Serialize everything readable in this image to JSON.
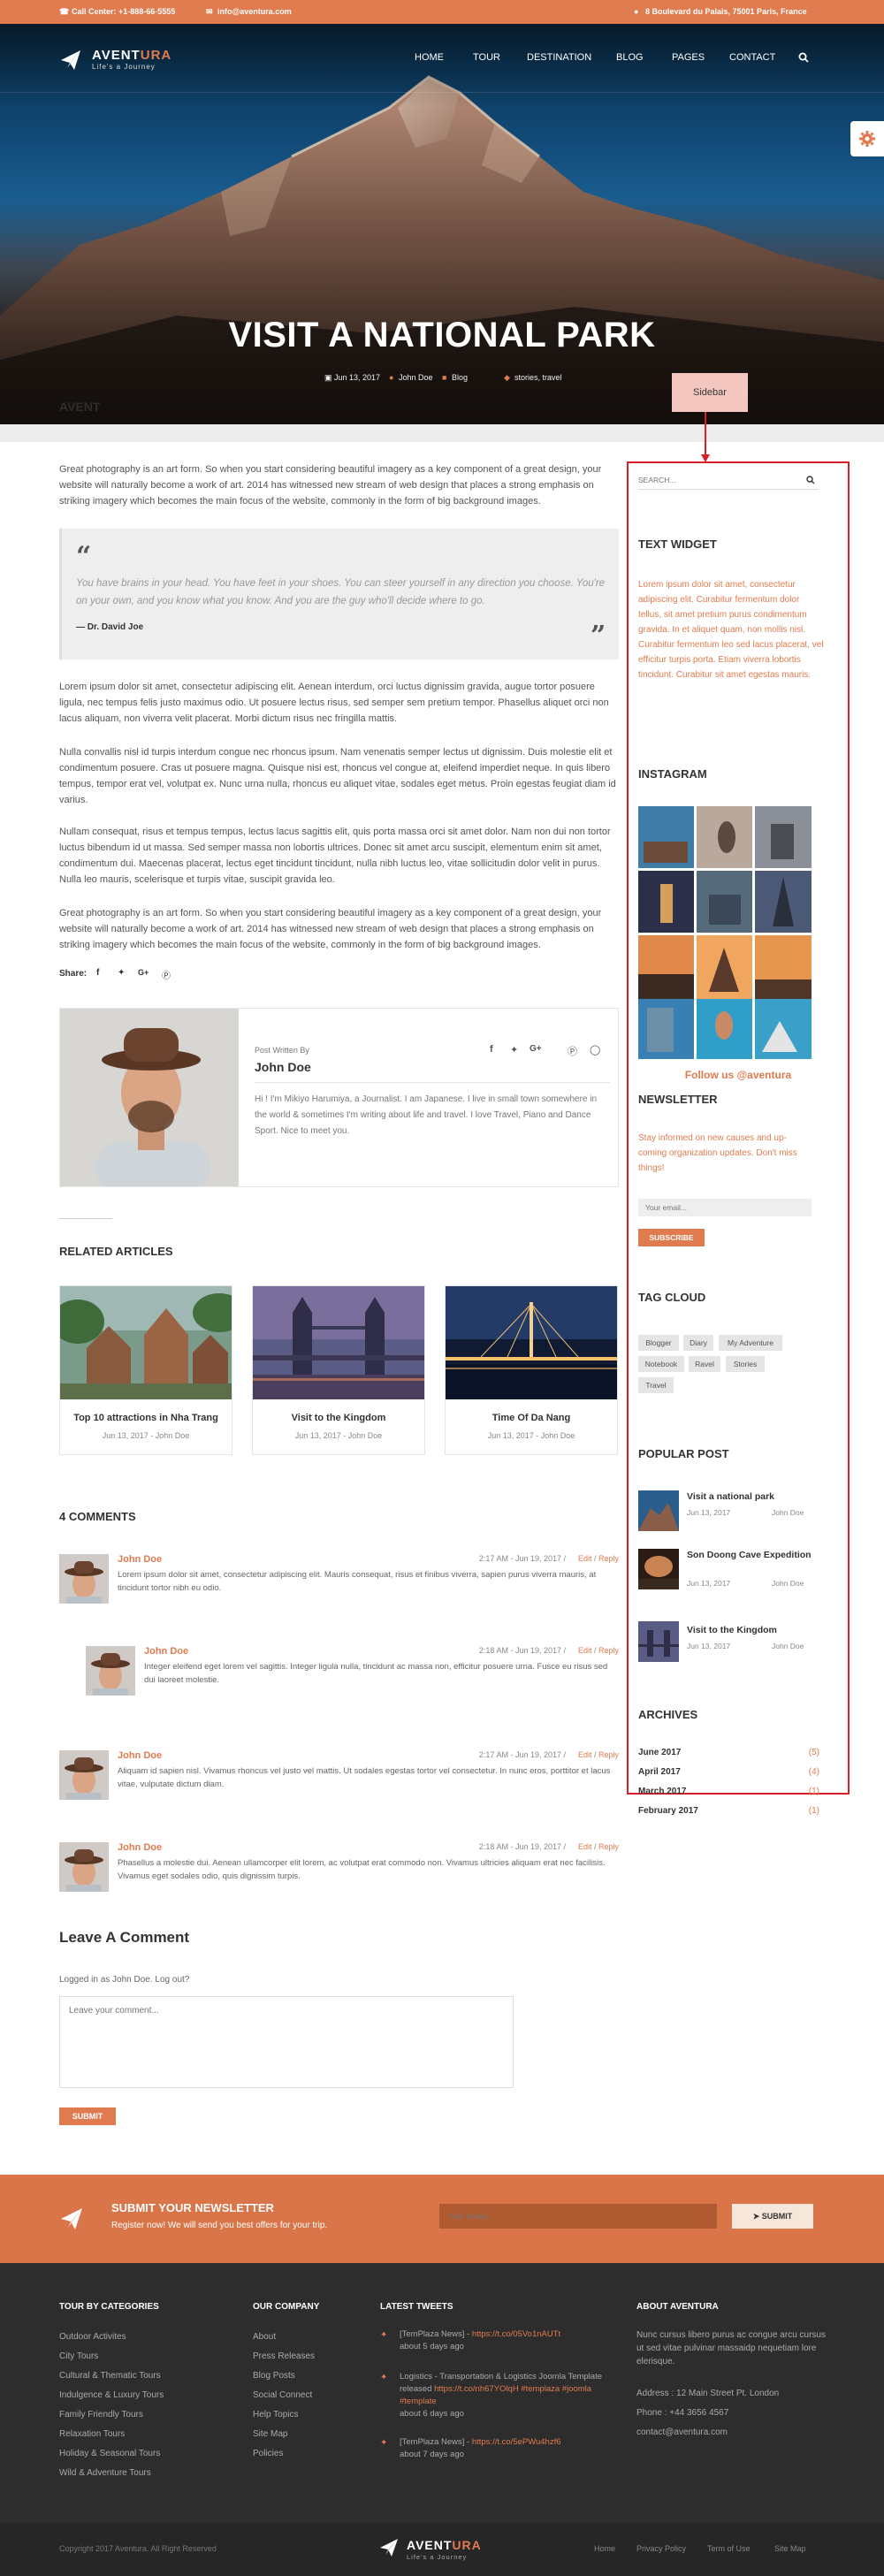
{
  "topbar": {
    "call": "Call Center: +1-888-66-5555",
    "email": "info@aventura.com",
    "address": "8 Boulevard du Palais, 75001 Paris, France"
  },
  "brand": {
    "name_a": "AVENT",
    "name_b": "URA",
    "tagline": "Life's a Journey"
  },
  "nav": {
    "items": [
      "HOME",
      "TOUR",
      "DESTINATION",
      "BLOG",
      "PAGES",
      "CONTACT"
    ]
  },
  "hero": {
    "title": "VISIT A NATIONAL PARK",
    "date": "Jun 13, 2017",
    "author": "John Doe",
    "category": "Blog",
    "tags": "stories, travel"
  },
  "annotation": {
    "sidebar_label": "Sidebar"
  },
  "article": {
    "p1": "Great photography is an art form. So when you start considering beautiful imagery as a key component of a great design, your website will naturally become a work of art. 2014 has witnessed new stream of web design that places a strong emphasis on striking imagery which becomes the main focus of the website, commonly in the form of big background images.",
    "quote_text": "You have brains in your head. You have feet in your shoes. You can steer yourself in any direction you choose. You're on your own, and you know what you know. And you are the guy who'll decide where to go.",
    "quote_author": "— Dr. David Joe",
    "p2": "Lorem ipsum dolor sit amet, consectetur adipiscing elit. Aenean interdum, orci luctus dignissim gravida, augue tortor posuere ligula, nec tempus felis justo maximus odio. Ut posuere lectus risus, sed semper sem pretium tempor. Phasellus aliquet orci non lacus aliquam, non viverra velit placerat. Morbi dictum risus nec fringilla mattis.",
    "p3": "Nulla convallis nisl id turpis interdum congue nec rhoncus ipsum. Nam venenatis semper lectus ut dignissim. Duis molestie elit et condimentum posuere. Cras ut posuere magna. Quisque nisi est, rhoncus vel congue at, eleifend imperdiet neque. In quis libero tempus, tempor erat vel, volutpat ex. Nunc urna nulla, rhoncus eu aliquet vitae, sodales eget metus. Proin egestas feugiat diam id varius.",
    "p4": "Nullam consequat, risus et tempus tempus, lectus lacus sagittis elit, quis porta massa orci sit amet dolor. Nam non dui non tortor luctus bibendum id ut massa. Sed semper massa non lobortis ultrices. Donec sit amet arcu suscipit, elementum enim sit amet, condimentum dui. Maecenas placerat, lectus eget tincidunt tincidunt, nulla nibh luctus leo, vitae sollicitudin dolor velit in purus. Nulla leo mauris, scelerisque et turpis vitae, suscipit gravida leo.",
    "p5": "Great photography is an art form. So when you start considering beautiful imagery as a key component of a great design, your website will naturally become a work of art. 2014 has witnessed new stream of web design that places a strong emphasis on striking imagery which becomes the main focus of the website, commonly in the form of big background images.",
    "share_label": "Share:"
  },
  "author_box": {
    "label": "Post Written By",
    "name": "John Doe",
    "bio": "Hi ! I'm Mikiyo Harumiya, a Journalist. I am Japanese. I live in small town somewhere in the world & sometimes I'm writing about life and travel. I love Travel, Piano and Dance Sport. Nice to meet you."
  },
  "related": {
    "heading": "RELATED ARTICLES",
    "items": [
      {
        "title": "Top 10 attractions in Nha Trang",
        "meta": "Jun 13, 2017 - John Doe"
      },
      {
        "title": "Visit to the Kingdom",
        "meta": "Jun 13, 2017 - John Doe"
      },
      {
        "title": "Time Of Da Nang",
        "meta": "Jun 13, 2017 - John Doe"
      }
    ]
  },
  "comments": {
    "heading": "4 COMMENTS",
    "items": [
      {
        "name": "John Doe",
        "date": "2:17 AM - Jun 19, 2017 /",
        "edit": "Edit",
        "reply": "Reply",
        "text": "Lorem ipsum dolor sit amet, consectetur adipiscing elit. Mauris consequat, risus et finibus viverra, sapien purus viverra mauris, at tincidunt tortor nibh eu odio."
      },
      {
        "name": "John Doe",
        "date": "2:18 AM - Jun 19, 2017 /",
        "edit": "Edit",
        "reply": "Reply",
        "text": "Integer eleifend eget lorem vel sagittis. Integer ligula nulla, tincidunt ac massa non, efficitur posuere urna. Fusce eu risus sed dui laoreet molestie."
      },
      {
        "name": "John Doe",
        "date": "2:17 AM - Jun 19, 2017 /",
        "edit": "Edit",
        "reply": "Reply",
        "text": "Aliquam id sapien nisl. Vivamus rhoncus vel justo vel mattis. Ut sodales egestas tortor vel consectetur. In nunc eros, porttitor et lacus vitae, vulputate dictum diam."
      },
      {
        "name": "John Doe",
        "date": "2:18 AM - Jun 19, 2017 /",
        "edit": "Edit",
        "reply": "Reply",
        "text": "Phasellus a molestie dui. Aenean ullamcorper elit lorem, ac volutpat erat commodo non. Vivamus ultricies aliquam erat nec facilisis. Vivamus eget sodales odio, quis dignissim turpis."
      }
    ]
  },
  "leave": {
    "heading": "Leave A Comment",
    "logged": "Logged in as John Doe. Log out?",
    "placeholder": "Leave your comment...",
    "submit": "SUBMIT"
  },
  "sidebar": {
    "search_placeholder": "SEARCH...",
    "text_widget_title": "TEXT WIDGET",
    "text_widget_body": "Lorem ipsum dolor sit amet, consectetur adipiscing elit. Curabitur fermentum dolor tellus, sit amet pretium purus condimentum gravida. In et aliquet quam, non mollis nisl. Curabitur fermentum leo sed lacus placerat, vel efficitur turpis porta. Etiam viverra lobortis tincidunt. Curabitur sit amet egestas mauris.",
    "instagram_title": "INSTAGRAM",
    "follow": "Follow us @aventura",
    "newsletter_title": "NEWSLETTER",
    "newsletter_body": "Stay informed on new causes and up-coming organization updates. Don't miss things!",
    "email_placeholder": "Your email...",
    "subscribe": "SUBSCRIBE",
    "tag_cloud_title": "TAG CLOUD",
    "tags": [
      "Blogger",
      "Diary",
      "My Adventure",
      "Notebook",
      "Ravel",
      "Stories",
      "Travel"
    ],
    "popular_title": "POPULAR POST",
    "popular": [
      {
        "title": "Visit a national park",
        "date": "Jun 13, 2017",
        "author": "John Doe"
      },
      {
        "title": "Son Doong Cave Expedition",
        "date": "Jun 13, 2017",
        "author": "John Doe"
      },
      {
        "title": "Visit to the Kingdom",
        "date": "Jun 13, 2017",
        "author": "John Doe"
      }
    ],
    "archives_title": "ARCHIVES",
    "archives": [
      {
        "month": "June 2017",
        "count": "(5)"
      },
      {
        "month": "April 2017",
        "count": "(4)"
      },
      {
        "month": "March 2017",
        "count": "(1)"
      },
      {
        "month": "February 2017",
        "count": "(1)"
      }
    ]
  },
  "newsletter_bar": {
    "title": "SUBMIT YOUR NEWSLETTER",
    "sub": "Register now! We will send you best offers for your trip.",
    "placeholder": "Your email...",
    "submit": "SUBMIT"
  },
  "footer": {
    "col1_title": "TOUR BY CATEGORIES",
    "col1": [
      "Outdoor Activites",
      "City Tours",
      "Cultural & Thematic Tours",
      "Indulgence & Luxury Tours",
      "Family Friendly Tours",
      "Relaxation Tours",
      "Holiday & Seasonal Tours",
      "Wild & Adventure Tours"
    ],
    "col2_title": "OUR COMPANY",
    "col2": [
      "About",
      "Press Releases",
      "Blog Posts",
      "Social Connect",
      "Help Topics",
      "Site Map",
      "Policies"
    ],
    "col3_title": "LATEST TWEETS",
    "tweets": [
      {
        "a": "[TemPlaza News] - ",
        "b": "https://t.co/05Vo1nAUTt",
        "c": "",
        "time": "about 5 days ago"
      },
      {
        "a": "Logistics - Transportation & Logistics Joomla Template released ",
        "b": "https://t.co/nh67YOlqH #templaza #joomla #template",
        "c": "",
        "time": "about 6 days ago"
      },
      {
        "a": "[TemPlaza News] - ",
        "b": "https://t.co/5ePWu4hzf6",
        "c": "",
        "time": "about 7 days ago"
      }
    ],
    "col4_title": "ABOUT AVENTURA",
    "about": "Nunc cursus libero purus ac congue arcu cursus ut sed vitae pulvinar massaidp nequetiam lore elerisque.",
    "address": "Address : 12 Main Street Pt. London",
    "phone": "Phone : +44 3656 4567",
    "mail": "contact@aventura.com",
    "copyright": "Copyright 2017 Aventura. All Right Reserved",
    "bottom_links": [
      "Home",
      "Privacy Policy",
      "Term of Use",
      "Site Map"
    ]
  },
  "colors": {
    "accent": "#e07b4f",
    "dark": "#2d2d2d",
    "sidebar_outline": "#d9202a"
  },
  "icons": [
    "phone-icon",
    "mail-icon",
    "location-icon",
    "search-icon",
    "gear-icon",
    "calendar-icon",
    "user-icon",
    "folder-icon",
    "tag-icon",
    "quote-icon",
    "facebook-icon",
    "twitter-icon",
    "google-plus-icon",
    "pinterest-icon",
    "instagram-icon",
    "paper-plane-icon"
  ]
}
